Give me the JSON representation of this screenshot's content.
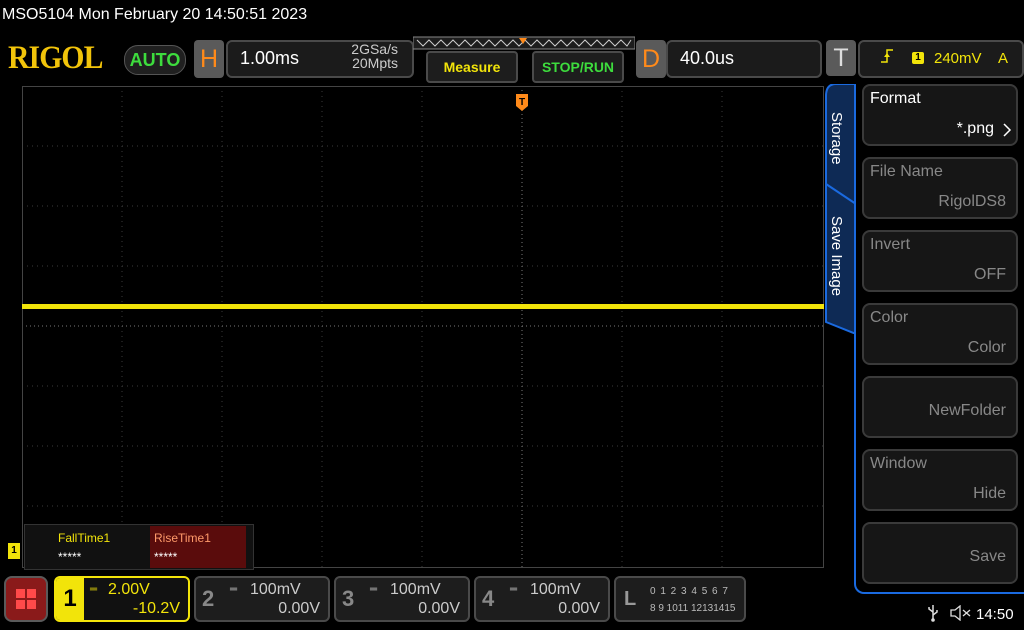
{
  "header": {
    "title": "MSO5104  Mon February 20 14:50:51 2023"
  },
  "topbar": {
    "logo": "RIGOL",
    "mode": "AUTO",
    "horizontal": {
      "letter": "H",
      "timebase": "1.00ms",
      "sample_rate": "2GSa/s",
      "memory_depth": "20Mpts"
    },
    "measure_label": "Measure",
    "stoprun_label": "STOP/RUN",
    "delay": {
      "letter": "D",
      "value": "40.0us"
    },
    "trigger": {
      "letter": "T",
      "source": "1",
      "level": "240mV",
      "mode": "A"
    }
  },
  "waveform": {
    "marker": "T"
  },
  "measurements": {
    "channel": "1",
    "items": [
      {
        "label": "FallTime1",
        "value": "*****"
      },
      {
        "label": "RiseTime1",
        "value": "*****"
      }
    ]
  },
  "menu": {
    "tabs": [
      "Storage",
      "Save Image"
    ],
    "items": [
      {
        "label": "Format",
        "value": "*.png",
        "enabled": true
      },
      {
        "label": "File Name",
        "value": "RigolDS8",
        "enabled": false
      },
      {
        "label": "Invert",
        "value": "OFF",
        "enabled": false
      },
      {
        "label": "Color",
        "value": "Color",
        "enabled": false
      },
      {
        "label": "",
        "value": "NewFolder",
        "enabled": false
      },
      {
        "label": "Window",
        "value": "Hide",
        "enabled": false
      },
      {
        "label": "",
        "value": "Save",
        "enabled": false
      }
    ]
  },
  "channels": [
    {
      "num": "1",
      "scale": "2.00V",
      "offset": "-10.2V",
      "active": true
    },
    {
      "num": "2",
      "scale": "100mV",
      "offset": "0.00V",
      "active": false
    },
    {
      "num": "3",
      "scale": "100mV",
      "offset": "0.00V",
      "active": false
    },
    {
      "num": "4",
      "scale": "100mV",
      "offset": "0.00V",
      "active": false
    }
  ],
  "logic": {
    "letter": "L",
    "row1": "0 1 2 3  4 5 6 7",
    "row2": "8 9 1011 12131415"
  },
  "status": {
    "time": "14:50"
  },
  "colors": {
    "ch1": "#f2e40a",
    "accent": "#1a6ae0",
    "trigger": "#ff8a1a",
    "run": "#3ddc3d"
  }
}
